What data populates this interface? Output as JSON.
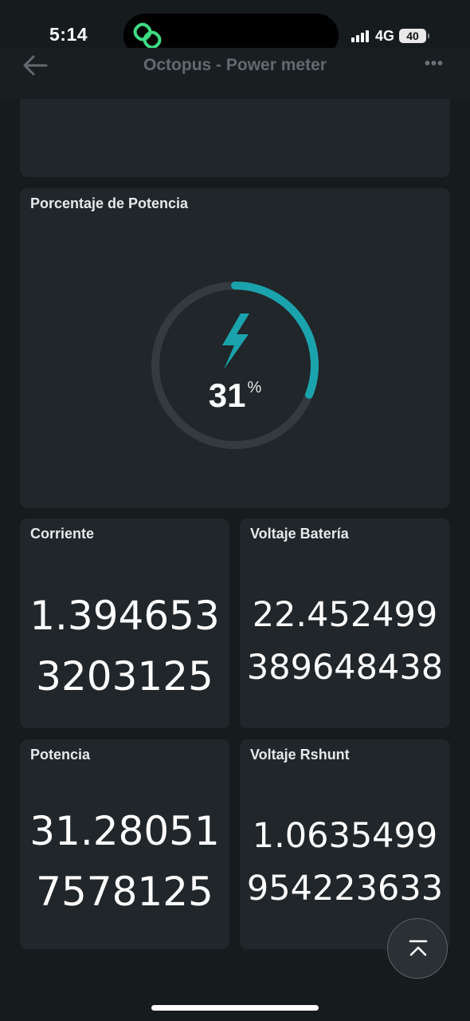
{
  "status_bar": {
    "time": "5:14",
    "network": "4G",
    "battery": "40",
    "signal_level": 4
  },
  "header": {
    "title": "Octopus - Power meter",
    "back_icon": "arrow-left-icon",
    "more_icon": "more-horizontal-icon",
    "more_glyph": "•••"
  },
  "gauge_card": {
    "title": "Porcentaje de Potencia",
    "value": "31",
    "unit": "%",
    "percent": 31,
    "icon": "lightning-bolt-icon",
    "accent_color": "#1ba3ad",
    "track_color": "#343b40"
  },
  "metrics": {
    "corriente": {
      "title": "Corriente",
      "lines": [
        "1.394653",
        "3203125"
      ]
    },
    "voltaje_bateria": {
      "title": "Voltaje Batería",
      "lines": [
        "22.452499",
        "389648438"
      ]
    },
    "potencia": {
      "title": "Potencia",
      "lines": [
        "31.28051",
        "7578125"
      ]
    },
    "voltaje_rshunt": {
      "title": "Voltaje Rshunt",
      "lines": [
        "1.0635499",
        "954223633"
      ]
    }
  },
  "scroll_top": {
    "icon": "arrow-up-to-top-icon"
  },
  "colors": {
    "background": "#161b1e",
    "card": "#202629",
    "accent": "#1ba3ad",
    "title_dim": "#626a70"
  }
}
